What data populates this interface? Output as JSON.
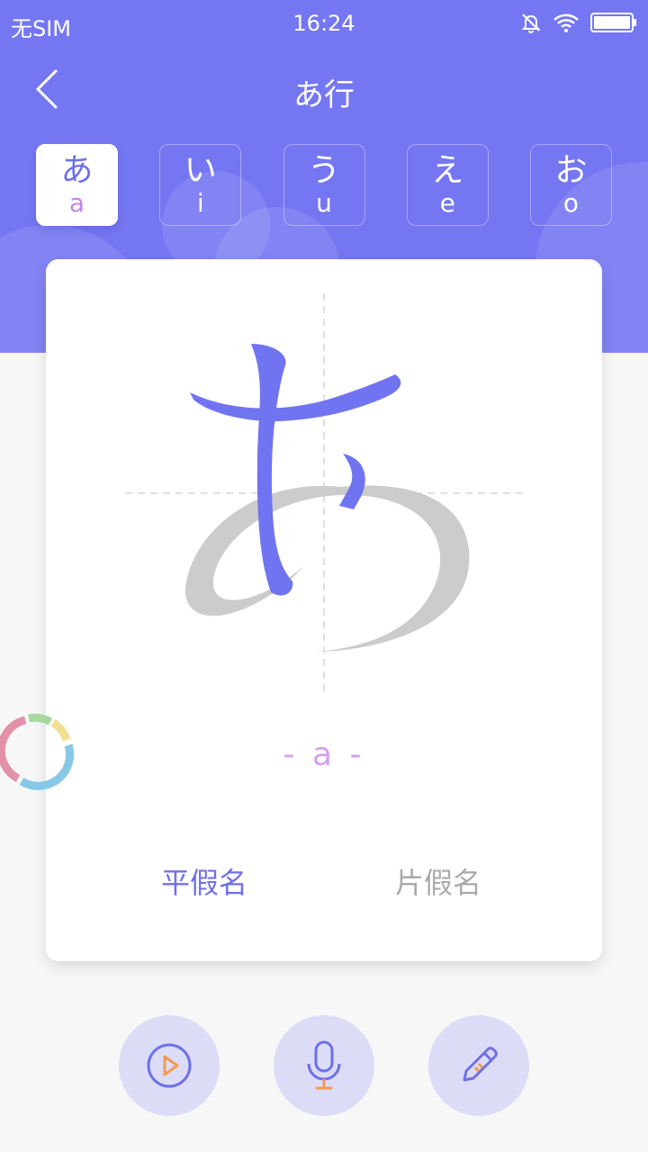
{
  "status_bar": {
    "carrier": "无SIM",
    "time": "16:24"
  },
  "nav": {
    "title": "あ行"
  },
  "tabs": [
    {
      "kana": "あ",
      "romaji": "a",
      "active": true
    },
    {
      "kana": "い",
      "romaji": "i",
      "active": false
    },
    {
      "kana": "う",
      "romaji": "u",
      "active": false
    },
    {
      "kana": "え",
      "romaji": "e",
      "active": false
    },
    {
      "kana": "お",
      "romaji": "o",
      "active": false
    }
  ],
  "card": {
    "romaji_display": "- a -",
    "script_options": {
      "hiragana": "平假名",
      "katakana": "片假名"
    },
    "selected_script": "hiragana"
  },
  "colors": {
    "primary": "#7577f2",
    "accent_text": "#6f70e8",
    "romaji": "#d79ef0",
    "stroke_done": "#7174f0",
    "stroke_pending": "#cccccc"
  },
  "actions": [
    {
      "icon": "play-circle-icon"
    },
    {
      "icon": "microphone-icon"
    },
    {
      "icon": "pencil-icon"
    }
  ]
}
